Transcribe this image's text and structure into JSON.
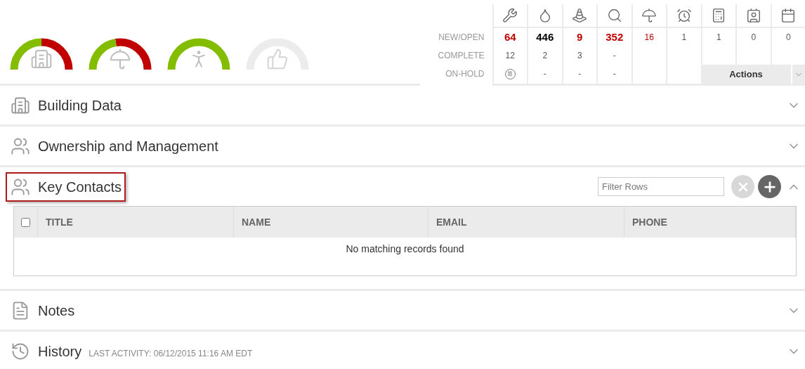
{
  "gauges": [
    {
      "level": 0.5,
      "active": true,
      "kind": "building"
    },
    {
      "level": 0.45,
      "active": true,
      "kind": "insurance"
    },
    {
      "level": 1,
      "active": true,
      "kind": "runner"
    },
    {
      "active": false,
      "kind": "approval"
    }
  ],
  "stats": {
    "row_labels": [
      "NEW/OPEN",
      "COMPLETE",
      "ON-HOLD"
    ],
    "columns": [
      {
        "kind": "tools",
        "new_open": {
          "value": "64",
          "bold": true,
          "color": "#c00000"
        },
        "complete": "12",
        "on_hold": {
          "kind": "paused"
        }
      },
      {
        "kind": "oil",
        "new_open": {
          "value": "446",
          "bold": true,
          "color": "#000000"
        },
        "complete": "2",
        "on_hold": {
          "kind": "text",
          "text": "-"
        }
      },
      {
        "kind": "cone",
        "new_open": {
          "value": "9",
          "bold": true,
          "color": "#c00000"
        },
        "complete": "3",
        "on_hold": {
          "kind": "text",
          "text": "-"
        }
      },
      {
        "kind": "search",
        "new_open": {
          "value": "352",
          "bold": true,
          "color": "#c00000"
        },
        "complete": "-",
        "on_hold": {
          "kind": "text",
          "text": "-"
        }
      },
      {
        "kind": "umbrella",
        "new_open": {
          "value": "16",
          "bold": false,
          "color": "#c00000"
        }
      },
      {
        "kind": "alarm",
        "new_open": {
          "value": "1",
          "bold": false,
          "color": "#555555"
        }
      },
      {
        "kind": "calculator",
        "new_open": {
          "value": "1",
          "bold": false,
          "color": "#555555"
        }
      },
      {
        "kind": "id",
        "new_open": {
          "value": "0",
          "bold": false,
          "color": "#555555"
        }
      },
      {
        "kind": "calendar",
        "new_open": {
          "value": "0",
          "bold": false,
          "color": "#555555"
        }
      }
    ],
    "actions": "Actions"
  },
  "sections": [
    {
      "kind": "building",
      "title": "Building Data",
      "expanded": false,
      "highlighted": false
    },
    {
      "kind": "people",
      "title": "Ownership and Management",
      "expanded": false,
      "highlighted": false
    },
    {
      "kind": "people",
      "title": "Key Contacts",
      "expanded": true,
      "highlighted": true,
      "filter_placeholder": "Filter Rows",
      "table": {
        "select_all": false,
        "columns": [
          "TITLE",
          "NAME",
          "EMAIL",
          "PHONE"
        ],
        "empty_message": "No matching records found"
      }
    },
    {
      "kind": "notes",
      "title": "Notes",
      "expanded": false,
      "highlighted": false
    },
    {
      "kind": "history",
      "title": "History",
      "subtitle": "LAST ACTIVITY: 06/12/2015 11:16 AM EDT",
      "expanded": false,
      "highlighted": false
    }
  ]
}
